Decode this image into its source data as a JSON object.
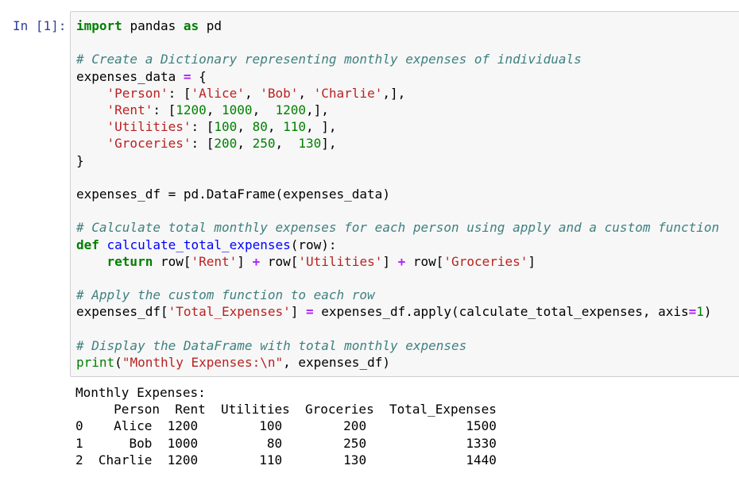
{
  "cell": {
    "prompt": "In [1]:"
  },
  "code": {
    "kw_import": "import",
    "mod_pandas": "pandas",
    "kw_as": "as",
    "alias_pd": "pd",
    "comment_create": "# Create a Dictionary representing monthly expenses of individuals",
    "var_expenses_data": "expenses_data",
    "eq": "=",
    "brace_open": "{",
    "key_person": "'Person'",
    "val_alice": "'Alice'",
    "val_bob": "'Bob'",
    "val_charlie": "'Charlie'",
    "key_rent": "'Rent'",
    "rent_1": "1200",
    "rent_2": "1000",
    "rent_3": "1200",
    "key_utilities": "'Utilities'",
    "util_1": "100",
    "util_2": "80",
    "util_3": "110",
    "key_groceries": "'Groceries'",
    "groc_1": "200",
    "groc_2": "250",
    "groc_3": "130",
    "brace_close": "}",
    "line_df_create": "expenses_df = pd.DataFrame(expenses_data)",
    "comment_calc": "# Calculate total monthly expenses for each person using apply and a custom function",
    "kw_def": "def",
    "func_name": "calculate_total_expenses",
    "func_params": "(row):",
    "kw_return": "return",
    "ret_key_rent": "'Rent'",
    "ret_key_util": "'Utilities'",
    "ret_key_groc": "'Groceries'",
    "comment_apply": "# Apply the custom function to each row",
    "key_total": "'Total_Expenses'",
    "apply_call": "expenses_df.apply(calculate_total_expenses, axis",
    "axis_val": "1",
    "comment_display": "# Display the DataFrame with total monthly expenses",
    "print_fn": "print",
    "print_str": "\"Monthly Expenses:\\n\"",
    "print_arg": ", expenses_df)"
  },
  "output": {
    "heading": "Monthly Expenses:",
    "columns": [
      "Person",
      "Rent",
      "Utilities",
      "Groceries",
      "Total_Expenses"
    ],
    "rows": [
      [
        "0",
        "Alice",
        "1200",
        "100",
        "200",
        "1500"
      ],
      [
        "1",
        "Bob",
        "1000",
        "80",
        "250",
        "1330"
      ],
      [
        "2",
        "Charlie",
        "1200",
        "110",
        "130",
        "1440"
      ]
    ]
  }
}
